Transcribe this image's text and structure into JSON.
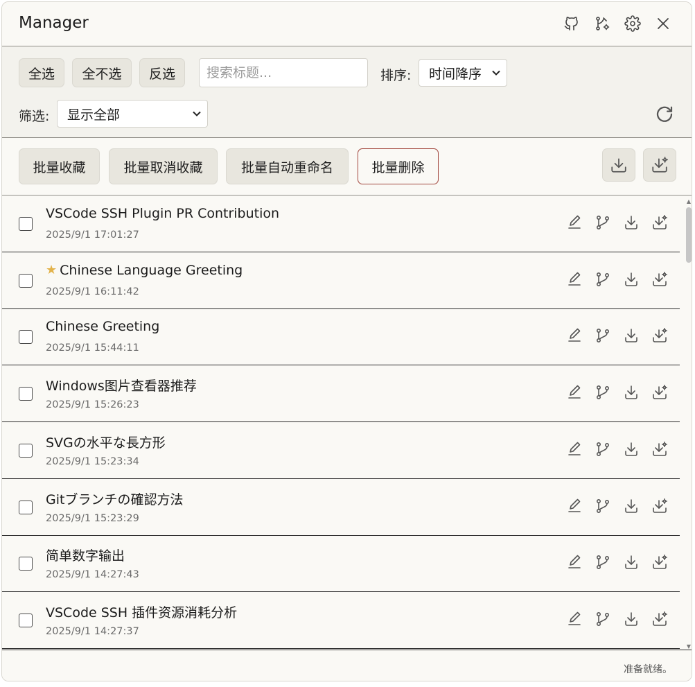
{
  "window": {
    "title": "Manager"
  },
  "header_icons": [
    "github-icon",
    "git-branch-settings-icon",
    "gear-icon",
    "close-icon"
  ],
  "toolbar": {
    "select_all": "全选",
    "select_none": "全不选",
    "invert": "反选",
    "search_placeholder": "搜索标题...",
    "sort_label": "排序:",
    "sort_value": "时间降序",
    "filter_label": "筛选:",
    "filter_value": "显示全部"
  },
  "batch": {
    "favorite": "批量收藏",
    "unfavorite": "批量取消收藏",
    "auto_rename": "批量自动重命名",
    "delete": "批量删除"
  },
  "conversations": [
    {
      "title": "VSCode SSH Plugin PR Contribution",
      "time": "2025/9/1 17:01:27",
      "starred": false
    },
    {
      "title": "Chinese Language Greeting",
      "time": "2025/9/1 16:11:42",
      "starred": true
    },
    {
      "title": "Chinese Greeting",
      "time": "2025/9/1 15:44:11",
      "starred": false
    },
    {
      "title": "Windows图片查看器推荐",
      "time": "2025/9/1 15:26:23",
      "starred": false
    },
    {
      "title": "SVGの水平な長方形",
      "time": "2025/9/1 15:23:34",
      "starred": false
    },
    {
      "title": "Gitブランチの確認方法",
      "time": "2025/9/1 15:23:29",
      "starred": false
    },
    {
      "title": "简单数字输出",
      "time": "2025/9/1 14:27:43",
      "starred": false
    },
    {
      "title": "VSCode SSH 插件资源消耗分析",
      "time": "2025/9/1 14:27:37",
      "starred": false
    }
  ],
  "status": {
    "text": "准备就绪。"
  },
  "colors": {
    "star": "#e2b24a",
    "danger_border": "#a1453c",
    "background": "#faf9f5"
  }
}
